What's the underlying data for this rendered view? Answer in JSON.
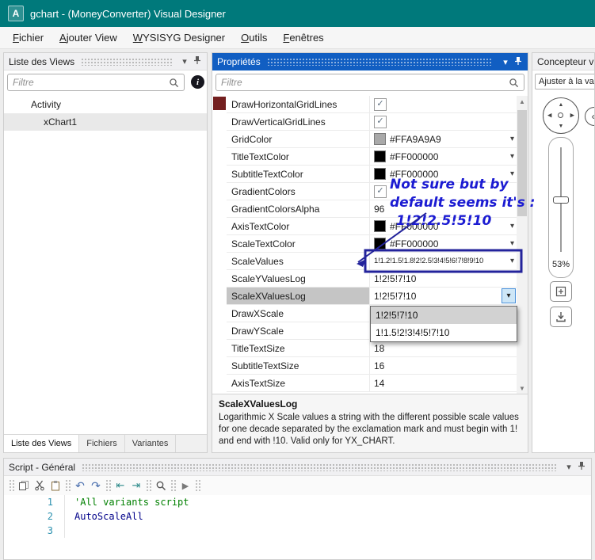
{
  "colors": {
    "titlebar": "#00797b",
    "accent": "#115ec2",
    "annotation_text": "#1b1bd2",
    "annotation_box": "#23239b"
  },
  "window": {
    "title": "gchart - (MoneyConverter) Visual Designer",
    "icon_letter": "A"
  },
  "menubar": {
    "items": [
      {
        "label": "Fichier"
      },
      {
        "label": "Ajouter View"
      },
      {
        "label": "WYSISYG Designer"
      },
      {
        "label": "Outils"
      },
      {
        "label": "Fenêtres"
      }
    ]
  },
  "views_panel": {
    "title": "Liste des Views",
    "filter": {
      "placeholder": "Filtre"
    },
    "tree_items": [
      {
        "label": "Activity",
        "selected": false,
        "indent": 1
      },
      {
        "label": "xChart1",
        "selected": true,
        "indent": 2
      }
    ],
    "tabs": [
      {
        "label": "Liste des Views",
        "active": true
      },
      {
        "label": "Fichiers",
        "active": false
      },
      {
        "label": "Variantes",
        "active": false
      }
    ]
  },
  "properties_panel": {
    "title": "Propriétés",
    "filter": {
      "placeholder": "Filtre"
    },
    "rows": [
      {
        "name": "DrawHorizontalGridLines",
        "kind": "checkbox",
        "checked": true
      },
      {
        "name": "DrawVerticalGridLines",
        "kind": "checkbox",
        "checked": true
      },
      {
        "name": "GridColor",
        "kind": "color",
        "value": "#FFA9A9A9",
        "swatch": "#A9A9A9"
      },
      {
        "name": "TitleTextColor",
        "kind": "color",
        "value": "#FF000000",
        "swatch": "#000000"
      },
      {
        "name": "SubtitleTextColor",
        "kind": "color",
        "value": "#FF000000",
        "swatch": "#000000"
      },
      {
        "name": "GradientColors",
        "kind": "checkbox",
        "checked": true
      },
      {
        "name": "GradientColorsAlpha",
        "kind": "text",
        "value": "96"
      },
      {
        "name": "AxisTextColor",
        "kind": "color",
        "value": "#FF000000",
        "swatch": "#000000"
      },
      {
        "name": "ScaleTextColor",
        "kind": "color",
        "value": "#FF000000",
        "swatch": "#000000"
      },
      {
        "name": "ScaleValues",
        "kind": "combo",
        "value": "1!1.2!1.5!1.8!2!2.5!3!4!5!6!7!8!9!10"
      },
      {
        "name": "ScaleYValuesLog",
        "kind": "text",
        "value": "1!2!5!7!10"
      },
      {
        "name": "ScaleXValuesLog",
        "kind": "combo-open",
        "value": "1!2!5!7!10",
        "selected": true
      },
      {
        "name": "DrawXScale",
        "kind": "text",
        "value": ""
      },
      {
        "name": "DrawYScale",
        "kind": "text",
        "value": ""
      },
      {
        "name": "TitleTextSize",
        "kind": "text",
        "value": "18"
      },
      {
        "name": "SubtitleTextSize",
        "kind": "text",
        "value": "16"
      },
      {
        "name": "AxisTextSize",
        "kind": "text",
        "value": "14"
      }
    ],
    "open_dropdown": {
      "for_row": "ScaleXValuesLog",
      "options": [
        {
          "label": "1!2!5!7!10",
          "highlighted": true
        },
        {
          "label": "1!1.5!2!3!4!5!7!10",
          "highlighted": false
        }
      ]
    },
    "description": {
      "title": "ScaleXValuesLog",
      "text": "Logarithmic X Scale values a string with the different possible scale values for one decade separated by the exclamation mark and must begin with 1! and end with !10. Valid only for YX_CHART."
    }
  },
  "annotation": {
    "lines": [
      "Not sure but by",
      "default seems it's :",
      "1!2!2.5!5!10"
    ]
  },
  "designer_panel": {
    "title": "Concepteur v",
    "fit_button": "Ajuster à la va",
    "zoom_percent": "53%"
  },
  "script_panel": {
    "title": "Script - Général",
    "toolbar_groups": [
      [
        "copy-icon",
        "cut-icon",
        "paste-icon"
      ],
      [
        "undo-icon",
        "redo-icon"
      ],
      [
        "outdent-icon",
        "indent-icon"
      ],
      [
        "search-icon"
      ],
      [
        "run-icon"
      ]
    ],
    "code_lines": [
      {
        "number": "1",
        "text": "'All variants script",
        "kind": "comment"
      },
      {
        "number": "2",
        "text": "AutoScaleAll",
        "kind": "keyword"
      },
      {
        "number": "3",
        "text": "",
        "kind": "plain"
      }
    ]
  }
}
